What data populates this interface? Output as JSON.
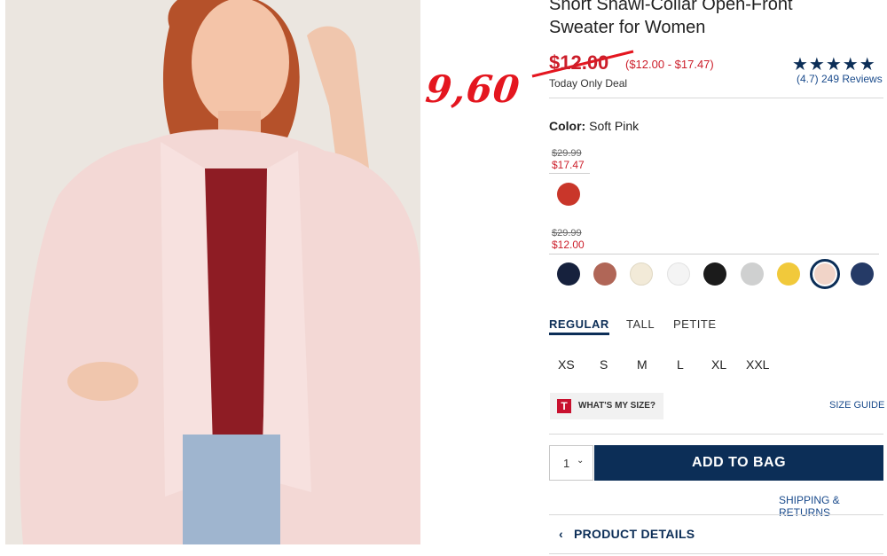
{
  "annotation": {
    "text": "9,60"
  },
  "product": {
    "title": "Short Shawl-Collar Open-Front Sweater for Women",
    "price": "$12.00",
    "price_range": "($12.00 - $17.47)",
    "deal_label": "Today Only Deal",
    "rating": {
      "stars": "★★★★★",
      "summary": "(4.7) 249 Reviews",
      "value": 4.7
    }
  },
  "color": {
    "label": "Color:",
    "value": "Soft Pink"
  },
  "price_groups": [
    {
      "old": "$29.99",
      "new": "$17.47"
    },
    {
      "old": "$29.99",
      "new": "$12.00"
    }
  ],
  "swatches": [
    {
      "name": "red",
      "color": "#c9362a"
    },
    {
      "name": "navy",
      "color": "#16213d"
    },
    {
      "name": "rust",
      "color": "#b06657"
    },
    {
      "name": "cream",
      "color": "#f2ead8"
    },
    {
      "name": "white",
      "color": "#f4f4f4"
    },
    {
      "name": "black",
      "color": "#1b1b1b"
    },
    {
      "name": "heather-gray",
      "color": "#cfd0d0"
    },
    {
      "name": "yellow",
      "color": "#f1c93b"
    },
    {
      "name": "soft-pink",
      "color": "#f1d4c8",
      "selected": true
    },
    {
      "name": "dark-blue",
      "color": "#253a66"
    }
  ],
  "fit_tabs": [
    "REGULAR",
    "TALL",
    "PETITE"
  ],
  "sizes": [
    "XS",
    "S",
    "M",
    "L",
    "XL",
    "XXL"
  ],
  "whats_my_size": {
    "badge": "T",
    "label": "WHAT'S MY SIZE?"
  },
  "size_guide": "SIZE GUIDE",
  "quantity": {
    "value": "1",
    "arrow": "⌄"
  },
  "add_to_bag": "ADD TO BAG",
  "shipping": "SHIPPING & RETURNS",
  "product_details": {
    "label": "PRODUCT DETAILS",
    "chevron": "‹"
  },
  "colors": {
    "brand_navy": "#0c2e57",
    "sale_red": "#cc1e2a",
    "link_blue": "#1a4b8c"
  }
}
